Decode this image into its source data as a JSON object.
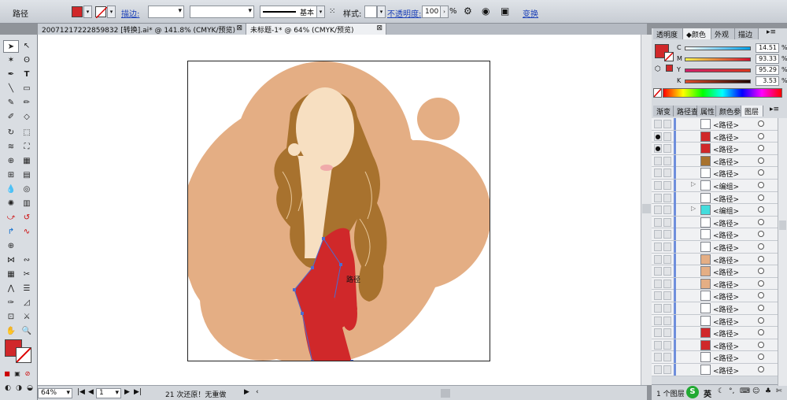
{
  "control_bar": {
    "object_type": "路径",
    "stroke_label": "描边:",
    "stroke_weight": "",
    "line_style": "基本",
    "style_label": "样式:",
    "opacity_label": "不透明度:",
    "opacity_value": "100",
    "opacity_unit": "%",
    "transform_label": "变换"
  },
  "document_tabs": [
    {
      "label": "20071217222859832 [转换].ai* @ 141.8% (CMYK/预览)"
    },
    {
      "label": "未标题-1* @ 64% (CMYK/预览)"
    }
  ],
  "canvas": {
    "path_tooltip": "路径"
  },
  "status_bar": {
    "zoom": "64%",
    "artboard_number": "1",
    "history_text": "21 次还原！无重做"
  },
  "color_panel": {
    "tabs": [
      "透明度",
      "颜色",
      "外观",
      "描边"
    ],
    "active_tab": "颜色",
    "channels": [
      {
        "label": "C",
        "value": "14.51",
        "gradient": "linear-gradient(to right,#fff,#00a0e9)"
      },
      {
        "label": "M",
        "value": "93.33",
        "gradient": "linear-gradient(to right,#f7f34f,#d40f2f)"
      },
      {
        "label": "Y",
        "value": "95.29",
        "gradient": "linear-gradient(to right,#d0206b,#d8371e)"
      },
      {
        "label": "K",
        "value": "3.53",
        "gradient": "linear-gradient(to right,#e24a2a,#200804)"
      }
    ],
    "percent": "%"
  },
  "layers_panel": {
    "tabs": [
      "渐变",
      "路径查",
      "属性",
      "颜色参",
      "图层"
    ],
    "active_tab": "图层",
    "rows": [
      {
        "name": "<路径>",
        "visible": false,
        "expand": false
      },
      {
        "name": "<路径>",
        "visible": true,
        "expand": false
      },
      {
        "name": "<路径>",
        "visible": true,
        "expand": false
      },
      {
        "name": "<路径>",
        "visible": false,
        "expand": false
      },
      {
        "name": "<路径>",
        "visible": false,
        "expand": false
      },
      {
        "name": "<编组>",
        "visible": false,
        "expand": true
      },
      {
        "name": "<路径>",
        "visible": false,
        "expand": false
      },
      {
        "name": "<编组>",
        "visible": false,
        "expand": true
      },
      {
        "name": "<路径>",
        "visible": false,
        "expand": false
      },
      {
        "name": "<路径>",
        "visible": false,
        "expand": false
      },
      {
        "name": "<路径>",
        "visible": false,
        "expand": false
      },
      {
        "name": "<路径>",
        "visible": false,
        "expand": false
      },
      {
        "name": "<路径>",
        "visible": false,
        "expand": false
      },
      {
        "name": "<路径>",
        "visible": false,
        "expand": false
      },
      {
        "name": "<路径>",
        "visible": false,
        "expand": false
      },
      {
        "name": "<路径>",
        "visible": false,
        "expand": false
      },
      {
        "name": "<路径>",
        "visible": false,
        "expand": false
      },
      {
        "name": "<路径>",
        "visible": false,
        "expand": false
      },
      {
        "name": "<路径>",
        "visible": false,
        "expand": false
      },
      {
        "name": "<路径>",
        "visible": false,
        "expand": false
      },
      {
        "name": "<路径>",
        "visible": false,
        "expand": false
      }
    ],
    "footer": "1 个图层",
    "ime_label": "英"
  },
  "colors": {
    "fill": "#d0282a",
    "bg_circle": "#e4ae84",
    "hair": "#a8722e",
    "skin": "#f7dfc1",
    "dress": "#d0282a"
  }
}
